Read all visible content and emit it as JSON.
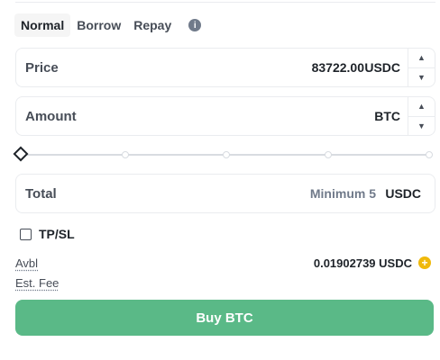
{
  "tabs": [
    {
      "label": "Normal",
      "active": true
    },
    {
      "label": "Borrow",
      "active": false
    },
    {
      "label": "Repay",
      "active": false
    }
  ],
  "price": {
    "label": "Price",
    "value": "83722.00",
    "unit": "USDC"
  },
  "amount": {
    "label": "Amount",
    "value": "",
    "unit": "BTC"
  },
  "slider": {
    "level_percent": 0,
    "marks": [
      0,
      25,
      50,
      75,
      100
    ]
  },
  "total": {
    "label": "Total",
    "placeholder": "Minimum 5",
    "unit": "USDC"
  },
  "tpsl": {
    "label": "TP/SL",
    "checked": false
  },
  "available": {
    "label": "Avbl",
    "value": "0.01902739 USDC"
  },
  "est_fee": {
    "label": "Est. Fee"
  },
  "buy_button": {
    "label": "Buy BTC"
  },
  "colors": {
    "buy": "#5ab987",
    "accent": "#f0b90b",
    "text": "#1e2329"
  },
  "icons": {
    "info": "info-icon",
    "stepper_up": "caret-up-icon",
    "stepper_down": "caret-down-icon",
    "deposit": "plus-circle-icon"
  }
}
